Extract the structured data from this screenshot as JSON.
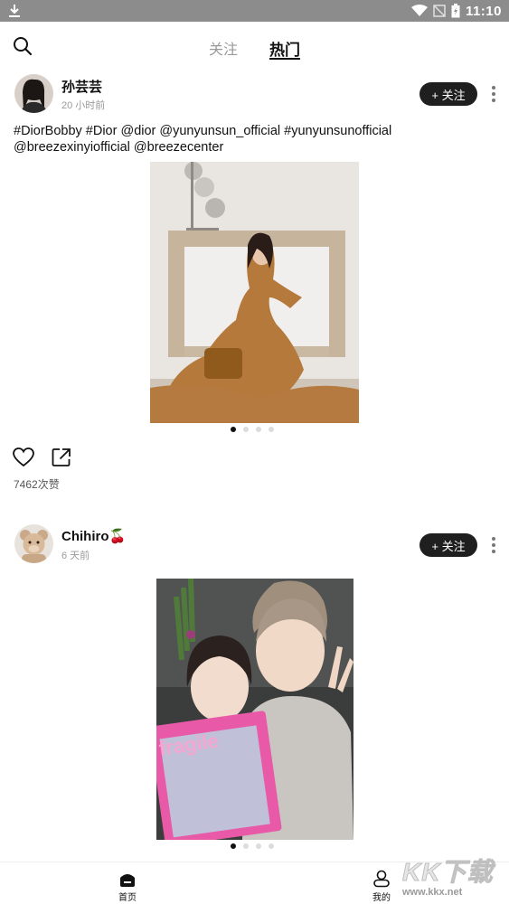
{
  "status_bar": {
    "time": "11:10",
    "icons": [
      "download-icon",
      "wifi-icon",
      "signal-off-icon",
      "battery-charging-icon"
    ]
  },
  "top_nav": {
    "tabs": [
      {
        "label": "关注",
        "active": false
      },
      {
        "label": "热门",
        "active": true
      }
    ],
    "search_icon": "search-icon"
  },
  "posts": [
    {
      "username": "孙芸芸",
      "time": "20 小时前",
      "follow_label": "+ 关注",
      "caption": "#DiorBobby #Dior @dior @yunyunsun_official #yunyunsunofficial @breezexinyiofficial @breezecenter",
      "page_count": 4,
      "active_page": 1,
      "likes": "7462次赞"
    },
    {
      "username": "Chihiro🍒",
      "time": "6 天前",
      "follow_label": "+ 关注",
      "caption": "",
      "page_count": 4,
      "active_page": 1
    }
  ],
  "bottom_nav": {
    "items": [
      {
        "label": "首页",
        "icon": "home-icon",
        "active": true
      },
      {
        "label": "我的",
        "icon": "profile-icon",
        "active": false
      }
    ]
  },
  "watermark": {
    "logo": "KK下载",
    "url": "www.kkx.net"
  },
  "colors": {
    "status_bar": "#8c8c8c",
    "follow_button": "#1f1f1f",
    "active_dot": "#111111",
    "inactive_dot": "#dcdcdc"
  }
}
